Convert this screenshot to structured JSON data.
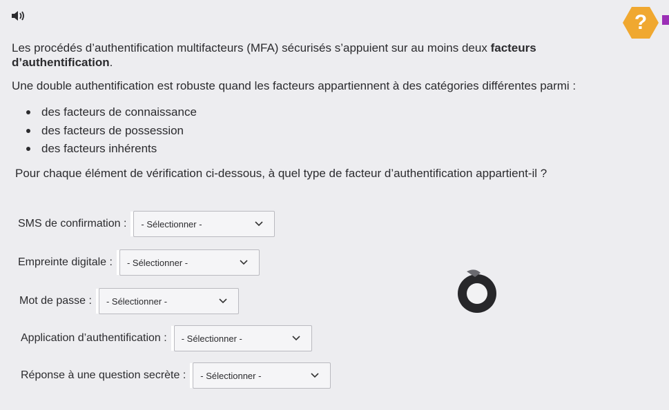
{
  "intro": {
    "p1_text": "Les procédés d’authentification multifacteurs (MFA) sécurisés s’appuient sur au moins deux ",
    "p1_bold": "facteurs d’authentification",
    "p1_end": ".",
    "p2": "Une double authentification est robuste quand les facteurs appartiennent à des catégories différentes parmi :"
  },
  "factors": [
    "des facteurs de connaissance",
    "des facteurs de possession",
    "des facteurs inhérents"
  ],
  "question": "Pour chaque élément de vérification ci-dessous, à quel type de facteur d’authentification appartient-il ?",
  "rows": [
    {
      "label": "SMS de confirmation :",
      "value": "- Sélectionner -"
    },
    {
      "label": "Empreinte digitale :",
      "value": "- Sélectionner -"
    },
    {
      "label": "Mot de passe :",
      "value": "- Sélectionner -"
    },
    {
      "label": "Application d’authentification :",
      "value": "- Sélectionner -"
    },
    {
      "label": "Réponse à une question secrète :",
      "value": "- Sélectionner -"
    }
  ],
  "help": {
    "glyph": "?"
  },
  "icons": {
    "audio": "speaker-icon",
    "help": "help-icon",
    "chevron": "chevron-down-icon",
    "stylus": "stylus-icon"
  },
  "colors": {
    "help_bg": "#f0a830",
    "accent": "#9b2fb6",
    "page_bg": "#ededf0"
  }
}
